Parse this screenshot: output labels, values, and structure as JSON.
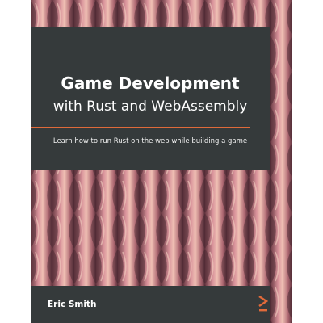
{
  "book": {
    "title_line1": "Game Development",
    "title_line2": "with Rust and WebAssembly",
    "subtitle": "Learn how to run Rust on the web while building a game",
    "author": "Eric Smith"
  },
  "colors": {
    "panel": "#353a3b",
    "accent": "#e06a3a",
    "pattern_base": "#b8707a",
    "pattern_light": "#e6a89a",
    "pattern_dark": "#6b3a44"
  },
  "icons": {
    "logo": "publisher-chevron-logo"
  }
}
